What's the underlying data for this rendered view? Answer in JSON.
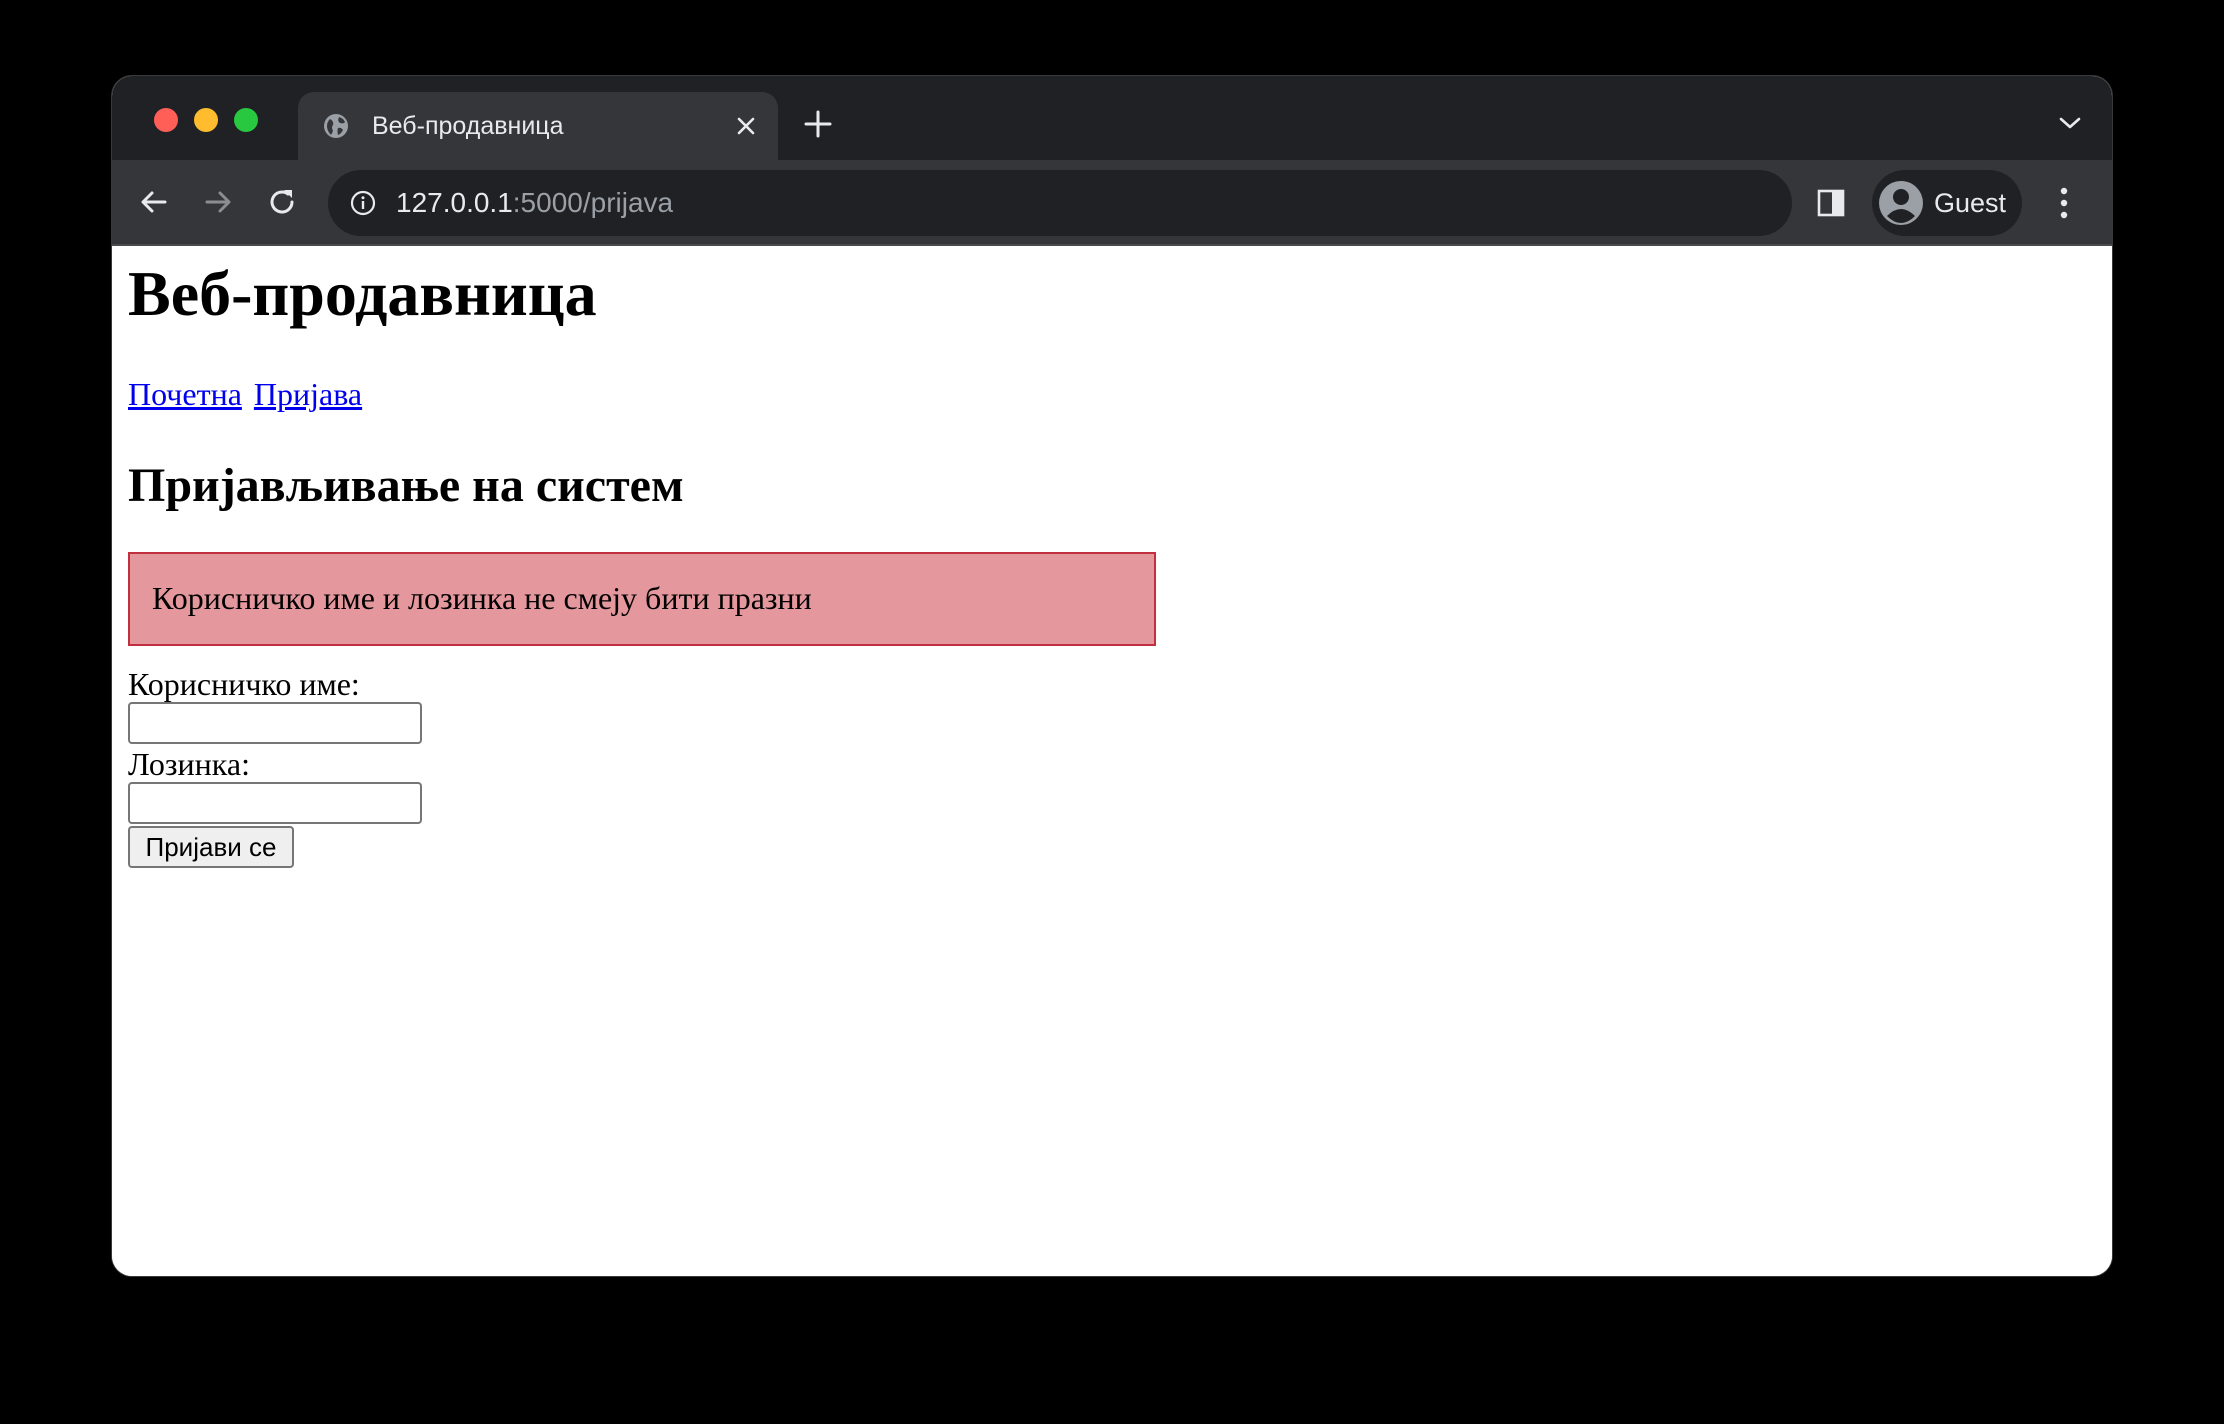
{
  "browser": {
    "tab_title": "Веб-продавница",
    "url_host": "127.0.0.1",
    "url_rest": ":5000/prijava",
    "profile_name": "Guest"
  },
  "page": {
    "site_title": "Веб-продавница",
    "nav": [
      "Почетна",
      "Пријава"
    ],
    "heading": "Пријављивање на систем",
    "alert": "Корисничко име и лозинка не смеју бити празни",
    "username_label": "Корисничко име:",
    "password_label": "Лозинка:",
    "submit_label": "Пријави се"
  }
}
